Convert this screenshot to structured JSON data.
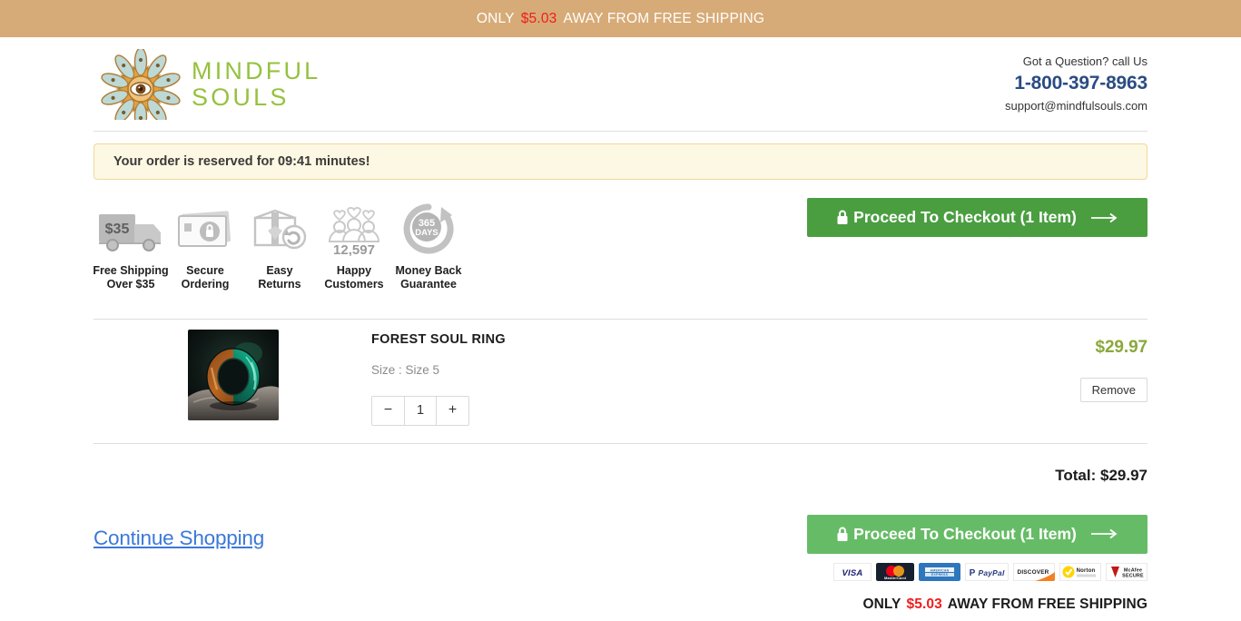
{
  "promo": {
    "pre": "ONLY",
    "amount": "$5.03",
    "post": "AWAY FROM FREE SHIPPING"
  },
  "header": {
    "brand_line1": "MINDFUL",
    "brand_line2": "SOULS",
    "question": "Got a Question? call Us",
    "phone": "1-800-397-8963",
    "email": "support@mindfulsouls.com"
  },
  "alert": {
    "text": "Your order is reserved for 09:41 minutes!"
  },
  "trust_badges": [
    {
      "icon": "shipping-truck-icon",
      "line1": "Free Shipping",
      "line2": "Over $35",
      "value": "$35"
    },
    {
      "icon": "secure-card-lock-icon",
      "line1": "Secure",
      "line2": "Ordering",
      "value": ""
    },
    {
      "icon": "return-box-icon",
      "line1": "Easy",
      "line2": "Returns",
      "value": ""
    },
    {
      "icon": "happy-customers-icon",
      "line1": "Happy",
      "line2": "Customers",
      "value": "12,597"
    },
    {
      "icon": "money-back-365-icon",
      "line1": "Money Back",
      "line2": "Guarantee",
      "value": "365 DAYS"
    }
  ],
  "checkout": {
    "label": "Proceed To Checkout (1 Item)",
    "lock_icon": "lock-icon",
    "arrow_icon": "arrow-right-icon",
    "top_color": "#4a9e40",
    "bottom_color": "#66bc66"
  },
  "cart": {
    "item": {
      "image_alt": "forest-soul-ring-photo",
      "title": "FOREST SOUL RING",
      "variant": "Size : Size 5",
      "quantity": "1",
      "decrement_label": "−",
      "increment_label": "+",
      "price": "$29.97",
      "remove_label": "Remove"
    },
    "total_label": "Total: $29.97"
  },
  "footer": {
    "continue_label": "Continue Shopping",
    "payment_badges": [
      {
        "name": "visa-badge",
        "label": "VISA"
      },
      {
        "name": "mastercard-badge",
        "label": "MasterCard"
      },
      {
        "name": "amex-badge",
        "label": "AMERICAN EXPRESS"
      },
      {
        "name": "paypal-badge",
        "label": "PayPal"
      },
      {
        "name": "discover-badge",
        "label": "DISCOVER"
      },
      {
        "name": "norton-badge",
        "label": "Norton"
      },
      {
        "name": "mcafee-badge",
        "label": "McAfee SECURE"
      }
    ],
    "free_ship_pre": "ONLY",
    "free_ship_amount": "$5.03",
    "free_ship_post": "AWAY FROM FREE SHIPPING"
  }
}
